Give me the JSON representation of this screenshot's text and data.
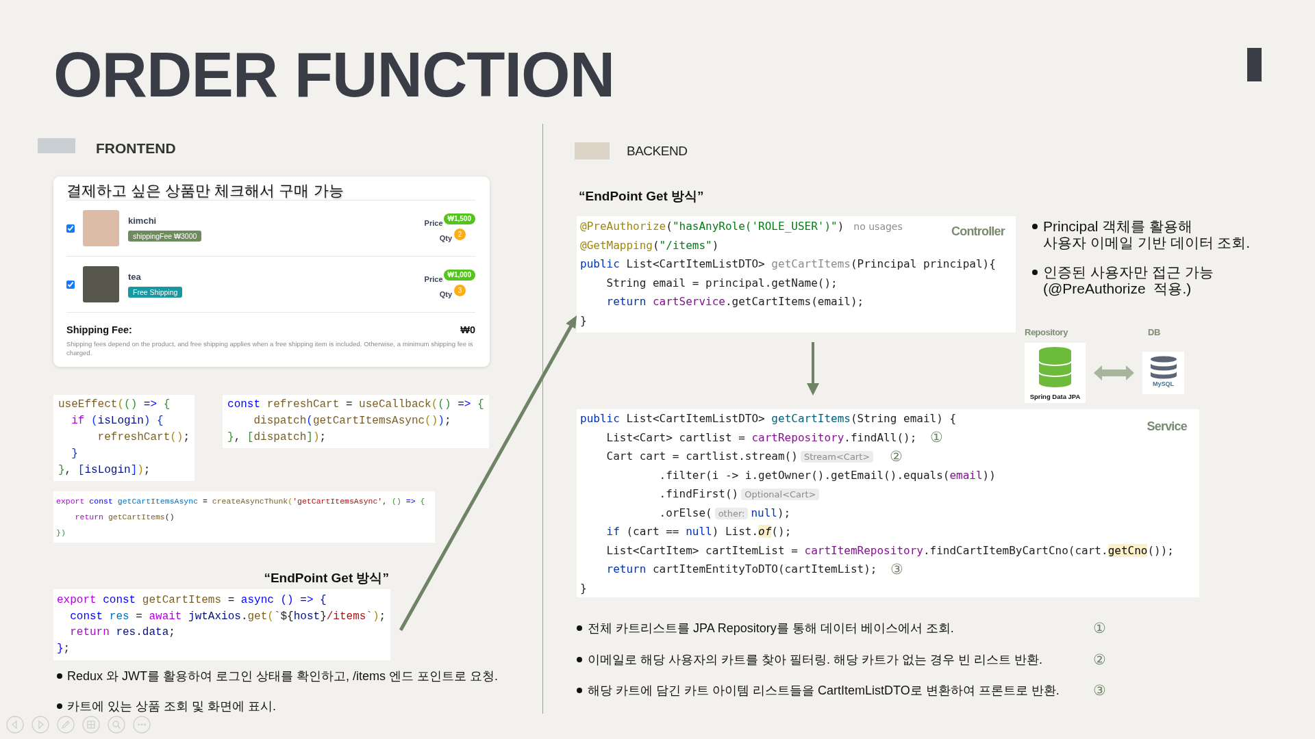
{
  "slide": {
    "title": "ORDER FUNCTION"
  },
  "frontend": {
    "heading": "FRONTEND",
    "cart": {
      "title": "결제하고 싶은 상품만 체크해서 구매 가능",
      "items": [
        {
          "name": "kimchi",
          "checked": true,
          "badge": {
            "kind": "fee",
            "text": "shippingFee ₩3000"
          },
          "price_label": "Price",
          "price": "₩1,500",
          "qty_label": "Qty",
          "qty": "2"
        },
        {
          "name": "tea",
          "checked": true,
          "badge": {
            "kind": "free",
            "text": "Free Shipping"
          },
          "price_label": "Price",
          "price": "₩1,000",
          "qty_label": "Qty",
          "qty": "3"
        }
      ],
      "shipping": {
        "label": "Shipping Fee:",
        "value": "₩0",
        "note": "Shipping fees depend on the product, and free shipping applies when a free shipping item is included. Otherwise, a minimum shipping fee is charged."
      }
    },
    "code_row": [
      {
        "lines": [
          {
            "tokens": [
              {
                "kind": "fn",
                "text": "useEffect"
              },
              {
                "kind": "br1",
                "text": "("
              },
              {
                "kind": "br2",
                "text": "()"
              },
              {
                "kind": "kw",
                "text": " =>"
              },
              {
                "kind": "br2",
                "text": " {"
              }
            ]
          },
          {
            "tokens": [
              {
                "kind": "ctrl",
                "text": "  if"
              },
              {
                "kind": "br3",
                "text": " ("
              },
              {
                "kind": "var",
                "text": "isLogin"
              },
              {
                "kind": "br3",
                "text": ")"
              },
              {
                "kind": "br3",
                "text": " {"
              }
            ]
          },
          {
            "tokens": [
              {
                "kind": "fn",
                "text": "      refreshCart"
              },
              {
                "kind": "br1",
                "text": "()"
              },
              {
                "kind": "plain",
                "text": ";"
              }
            ]
          },
          {
            "tokens": [
              {
                "kind": "br3",
                "text": "  }"
              }
            ]
          },
          {
            "tokens": [
              {
                "kind": "br2",
                "text": "}"
              },
              {
                "kind": "plain",
                "text": ", "
              },
              {
                "kind": "br3",
                "text": "["
              },
              {
                "kind": "var",
                "text": "isLogin"
              },
              {
                "kind": "br3",
                "text": "]"
              },
              {
                "kind": "br1",
                "text": ")"
              },
              {
                "kind": "plain",
                "text": ";"
              }
            ]
          }
        ]
      },
      {
        "lines": [
          {
            "tokens": [
              {
                "kind": "kw",
                "text": "const"
              },
              {
                "kind": "fn",
                "text": " refreshCart"
              },
              {
                "kind": "plain",
                "text": " = "
              },
              {
                "kind": "fn",
                "text": "useCallback"
              },
              {
                "kind": "br1",
                "text": "("
              },
              {
                "kind": "br2",
                "text": "()"
              },
              {
                "kind": "kw",
                "text": " =>"
              },
              {
                "kind": "br2",
                "text": " {"
              }
            ]
          },
          {
            "tokens": [
              {
                "kind": "fn",
                "text": "    dispatch"
              },
              {
                "kind": "br3",
                "text": "("
              },
              {
                "kind": "fn",
                "text": "getCartItemsAsync"
              },
              {
                "kind": "br1",
                "text": "()"
              },
              {
                "kind": "br3",
                "text": ")"
              },
              {
                "kind": "plain",
                "text": ";"
              }
            ]
          },
          {
            "tokens": [
              {
                "kind": "br2",
                "text": "}"
              },
              {
                "kind": "plain",
                "text": ", "
              },
              {
                "kind": "br2",
                "text": "["
              },
              {
                "kind": "fn",
                "text": "dispatch"
              },
              {
                "kind": "br2",
                "text": "]"
              },
              {
                "kind": "br1",
                "text": ")"
              },
              {
                "kind": "plain",
                "text": ";"
              }
            ]
          }
        ]
      }
    ],
    "thunk_code": {
      "lines": [
        {
          "tokens": [
            {
              "kind": "ctrl",
              "text": "export"
            },
            {
              "kind": "kw",
              "text": " const"
            },
            {
              "kind": "var2",
              "text": " getCartItemsAsync"
            },
            {
              "kind": "plain",
              "text": " = "
            },
            {
              "kind": "fn",
              "text": "createAsyncThunk"
            },
            {
              "kind": "br1",
              "text": "("
            },
            {
              "kind": "str",
              "text": "'getCartItemsAsync'"
            },
            {
              "kind": "plain",
              "text": ", "
            },
            {
              "kind": "br2",
              "text": "()"
            },
            {
              "kind": "kw",
              "text": " =>"
            },
            {
              "kind": "br2",
              "text": " {"
            }
          ]
        },
        {
          "tokens": [
            {
              "kind": "ctrl",
              "text": "    return"
            },
            {
              "kind": "fn",
              "text": " getCartItems"
            },
            {
              "kind": "plain",
              "text": "()"
            }
          ]
        },
        {
          "tokens": [
            {
              "kind": "br2",
              "text": "})"
            }
          ]
        }
      ]
    },
    "endpoint": {
      "label": "“EndPoint Get 방식”",
      "code": {
        "lines": [
          {
            "tokens": [
              {
                "kind": "ctrl",
                "text": "export"
              },
              {
                "kind": "kw",
                "text": " const"
              },
              {
                "kind": "fn",
                "text": " getCartItems"
              },
              {
                "kind": "plain",
                "text": " = "
              },
              {
                "kind": "kw",
                "text": "async () => {"
              }
            ]
          },
          {
            "tokens": [
              {
                "kind": "kw",
                "text": "  const"
              },
              {
                "kind": "var2",
                "text": " res"
              },
              {
                "kind": "plain",
                "text": " = "
              },
              {
                "kind": "ctrl",
                "text": "await"
              },
              {
                "kind": "var",
                "text": " jwtAxios"
              },
              {
                "kind": "plain",
                "text": "."
              },
              {
                "kind": "fn",
                "text": "get"
              },
              {
                "kind": "br1",
                "text": "("
              },
              {
                "kind": "str",
                "text": "`"
              },
              {
                "kind": "plain",
                "text": "${"
              },
              {
                "kind": "var",
                "text": "host"
              },
              {
                "kind": "plain",
                "text": "}"
              },
              {
                "kind": "str",
                "text": "/items`"
              },
              {
                "kind": "br1",
                "text": ")"
              },
              {
                "kind": "plain",
                "text": ";"
              }
            ]
          },
          {
            "tokens": [
              {
                "kind": "ctrl",
                "text": "  return"
              },
              {
                "kind": "var",
                "text": " res"
              },
              {
                "kind": "plain",
                "text": "."
              },
              {
                "kind": "var",
                "text": "data"
              },
              {
                "kind": "plain",
                "text": ";"
              }
            ]
          },
          {
            "tokens": [
              {
                "kind": "kw",
                "text": "}"
              },
              {
                "kind": "plain",
                "text": ";"
              }
            ]
          }
        ]
      }
    },
    "bullets": [
      "Redux 와 JWT를 활용하여 로그인 상태를 확인하고, /items 엔드 포인트로 요청.",
      "카트에 있는 상품 조회 및 화면에 표시."
    ]
  },
  "backend": {
    "heading": "BACKEND",
    "endpoint_label": "“EndPoint Get 방식”",
    "controller": {
      "label": "Controller",
      "lines": [
        {
          "tokens": [
            {
              "kind": "ann",
              "text": "@PreAuthorize"
            },
            {
              "kind": "plain",
              "text": "("
            },
            {
              "kind": "jstr",
              "text": "\"hasAnyRole('ROLE_USER')\""
            },
            {
              "kind": "plain",
              "text": ")"
            },
            {
              "kind": "usage",
              "text": "no usages"
            }
          ]
        },
        {
          "tokens": [
            {
              "kind": "ann",
              "text": "@GetMapping"
            },
            {
              "kind": "plain",
              "text": "("
            },
            {
              "kind": "jstr",
              "text": "\"/items\""
            },
            {
              "kind": "plain",
              "text": ")"
            }
          ]
        },
        {
          "tokens": [
            {
              "kind": "jkw",
              "text": "public"
            },
            {
              "kind": "plain",
              "text": " List<CartItemListDTO> "
            },
            {
              "kind": "unused",
              "text": "getCartItems"
            },
            {
              "kind": "plain",
              "text": "(Principal principal){"
            }
          ]
        },
        {
          "tokens": [
            {
              "kind": "plain",
              "text": "    String email = principal.getName();"
            }
          ]
        },
        {
          "tokens": [
            {
              "kind": "jkw",
              "text": "    return"
            },
            {
              "kind": "field",
              "text": " cartService"
            },
            {
              "kind": "plain",
              "text": ".getCartItems(email);"
            }
          ]
        },
        {
          "tokens": [
            {
              "kind": "plain",
              "text": "}"
            }
          ]
        }
      ]
    },
    "notes": [
      "Principal 객체를 활용해\n사용자 이메일 기반 데이터 조회.",
      "인증된 사용자만 접근 가능\n(@PreAuthorize  적용.)"
    ],
    "repository": {
      "label": "Repository",
      "caption": "Spring Data JPA"
    },
    "database": {
      "label": "DB",
      "logo_text": "MySQL"
    },
    "service": {
      "label": "Service",
      "lines": [
        {
          "tokens": [
            {
              "kind": "jkw",
              "text": "public"
            },
            {
              "kind": "plain",
              "text": " List<CartItemListDTO> "
            },
            {
              "kind": "decl",
              "text": "getCartItems"
            },
            {
              "kind": "plain",
              "text": "(String email) {"
            }
          ]
        },
        {
          "tokens": [
            {
              "kind": "plain",
              "text": "    List<Cart> cartlist = "
            },
            {
              "kind": "field",
              "text": "cartRepository"
            },
            {
              "kind": "plain",
              "text": ".findAll();"
            }
          ],
          "step": "①"
        },
        {
          "tokens": [
            {
              "kind": "plain",
              "text": "    Cart cart = cartlist.stream()"
            },
            {
              "kind": "hint",
              "text": "Stream<Cart>"
            }
          ],
          "step": "②"
        },
        {
          "tokens": [
            {
              "kind": "plain",
              "text": "            .filter(i -> i.getOwner().getEmail().equals("
            },
            {
              "kind": "field",
              "text": "email"
            },
            {
              "kind": "plain",
              "text": "))"
            }
          ]
        },
        {
          "tokens": [
            {
              "kind": "plain",
              "text": "            .findFirst()"
            },
            {
              "kind": "hint",
              "text": "Optional<Cart>"
            }
          ]
        },
        {
          "tokens": [
            {
              "kind": "plain",
              "text": "            .orElse("
            },
            {
              "kind": "hint",
              "text": "other:"
            },
            {
              "kind": "jkw",
              "text": "null"
            },
            {
              "kind": "plain",
              "text": ");"
            }
          ]
        },
        {
          "tokens": [
            {
              "kind": "jkw",
              "text": "    if"
            },
            {
              "kind": "plain",
              "text": " (cart == "
            },
            {
              "kind": "jkw",
              "text": "null"
            },
            {
              "kind": "plain",
              "text": ") List."
            },
            {
              "kind": "hl_italic",
              "text": "of"
            },
            {
              "kind": "plain",
              "text": "();"
            }
          ]
        },
        {
          "tokens": [
            {
              "kind": "plain",
              "text": "    List<CartItem> cartItemList = "
            },
            {
              "kind": "field",
              "text": "cartItemRepository"
            },
            {
              "kind": "plain",
              "text": ".findCartItemByCartCno(cart."
            },
            {
              "kind": "hl",
              "text": "getCno"
            },
            {
              "kind": "plain",
              "text": "());"
            }
          ]
        },
        {
          "tokens": [
            {
              "kind": "jkw",
              "text": "    return"
            },
            {
              "kind": "plain",
              "text": " cartItemEntityToDTO(cartItemList);"
            }
          ],
          "step": "③"
        },
        {
          "tokens": [
            {
              "kind": "plain",
              "text": "}"
            }
          ]
        }
      ]
    },
    "bullets": [
      {
        "text": "전체 카트리스트를 JPA Repository를 통해 데이터 베이스에서 조회.",
        "step": "①"
      },
      {
        "text": "이메일로 해당 사용자의 카트를 찾아 필터링. 해당 카트가 없는 경우 빈 리스트 반환.",
        "step": "②"
      },
      {
        "text": "해당 카트에 담긴 카트 아이템 리스트들을 CartItemListDTO로 변환하여 프론트로 반환.",
        "step": "③"
      }
    ]
  }
}
